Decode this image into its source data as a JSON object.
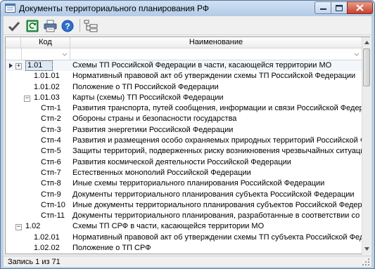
{
  "window": {
    "title": "Документы территориального планирования РФ"
  },
  "toolbar": {
    "buttons": [
      {
        "icon": "checkmark-icon",
        "tooltip": ""
      },
      {
        "icon": "refresh-icon",
        "tooltip": ""
      },
      {
        "icon": "printer-icon",
        "tooltip": ""
      },
      {
        "icon": "help-icon",
        "tooltip": ""
      },
      {
        "icon": "tree-icon",
        "tooltip": ""
      }
    ]
  },
  "grid": {
    "columns": [
      "Код",
      "Наименование"
    ],
    "rows": [
      {
        "code": "1.01",
        "name": "Схемы ТП Российской Федерации в части, касающейся территории МО",
        "level": 0,
        "expander": "plus",
        "selected": true
      },
      {
        "code": "1.01.01",
        "name": "Нормативный правовой акт об утверждении схемы ТП Российской Федерации",
        "level": 1,
        "expander": ""
      },
      {
        "code": "1.01.02",
        "name": "Положение о ТП Российской Федерации",
        "level": 1,
        "expander": ""
      },
      {
        "code": "1.01.03",
        "name": "Карты (схемы) ТП Российской Федерации",
        "level": 1,
        "expander": "minus"
      },
      {
        "code": "Стп-1",
        "name": "Развития транспорта, путей сообщения, информации и связи Российской Федерации",
        "level": 2,
        "expander": ""
      },
      {
        "code": "Стп-2",
        "name": "Обороны страны и безопасности государства",
        "level": 2,
        "expander": ""
      },
      {
        "code": "Стп-3",
        "name": "Развития энергетики Российской Федерации",
        "level": 2,
        "expander": ""
      },
      {
        "code": "Стп-4",
        "name": "Развития и размещения особо охраняемых природных территорий Российской Федерац",
        "level": 2,
        "expander": ""
      },
      {
        "code": "Стп-5",
        "name": "Защиты территорий, подверженных риску возникновения чрезвычайных ситуаций прир",
        "level": 2,
        "expander": ""
      },
      {
        "code": "Стп-6",
        "name": "Развития космической деятельности Российской Федерации",
        "level": 2,
        "expander": ""
      },
      {
        "code": "Стп-7",
        "name": "Естественных монополий Российской Федерации",
        "level": 2,
        "expander": ""
      },
      {
        "code": "Стп-8",
        "name": "Иные схемы территориального планирования Российской Федерации",
        "level": 2,
        "expander": ""
      },
      {
        "code": "Стп-9",
        "name": "Документы территориального планирования субъекта Российской Федерации",
        "level": 2,
        "expander": ""
      },
      {
        "code": "Стп-10",
        "name": "Иные документы территориального планирования субъектов Российской Федерации",
        "level": 2,
        "expander": ""
      },
      {
        "code": "Стп-11",
        "name": "Документы территориального планирования, разработанные в соответствии со статьей",
        "level": 2,
        "expander": ""
      },
      {
        "code": "1.02",
        "name": "Схемы ТП СРФ в части, касающейся территории МО",
        "level": 0,
        "expander": "minus"
      },
      {
        "code": "1.02.01",
        "name": "Нормативный правовой акт об утверждении схемы ТП субъекта Российской Федерации",
        "level": 1,
        "expander": ""
      },
      {
        "code": "1.02.02",
        "name": "Положение о ТП СРФ",
        "level": 1,
        "expander": ""
      }
    ]
  },
  "status": {
    "text": "Запись 1 из 71"
  },
  "colors": {
    "titlebar": "#bcd0e6",
    "selection": "#dde8f6"
  }
}
